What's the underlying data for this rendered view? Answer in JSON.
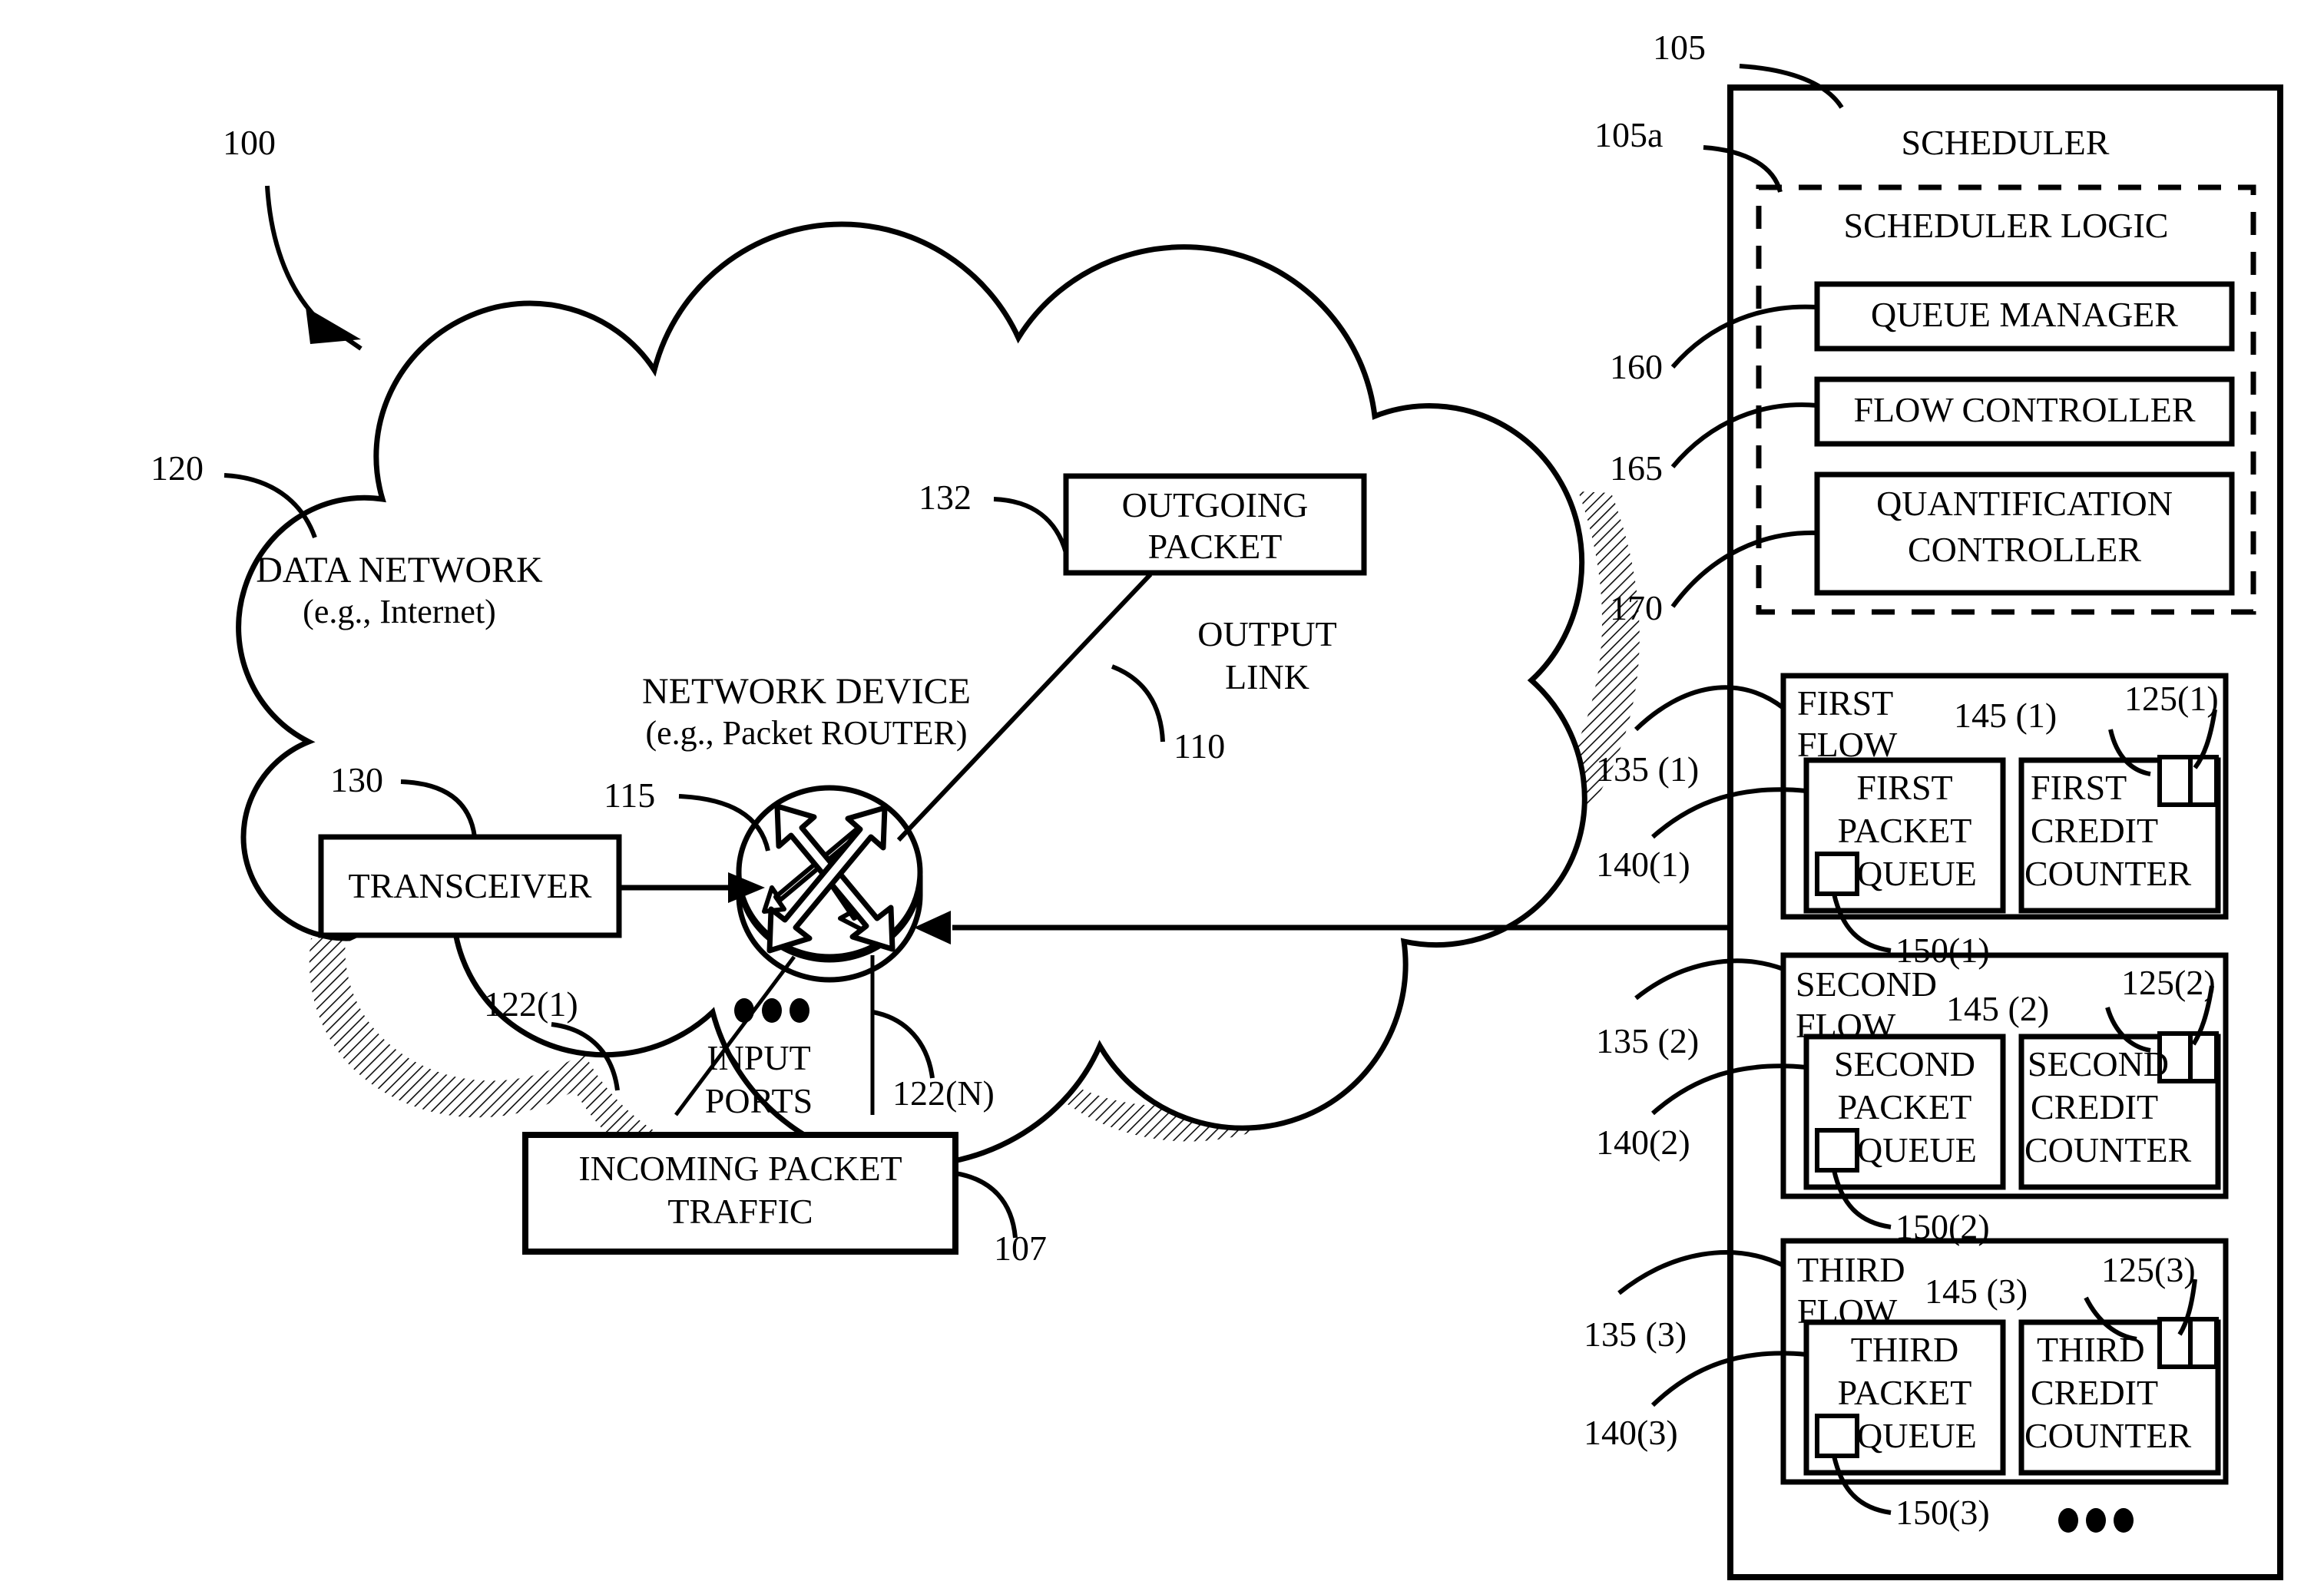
{
  "figure": {
    "ref_main": "100",
    "title_hidden": ""
  },
  "cloud": {
    "ref": "120",
    "label_line1": "DATA NETWORK",
    "label_line2": "(e.g., Internet)"
  },
  "router": {
    "ref": "115",
    "label_line1": "NETWORK DEVICE",
    "label_line2": "(e.g., Packet ROUTER)",
    "icon": "router-crossed-arrows-icon"
  },
  "transceiver": {
    "ref": "130",
    "label": "TRANSCEIVER"
  },
  "outgoing_packet": {
    "ref": "132",
    "label_line1": "OUTGOING",
    "label_line2": "PACKET"
  },
  "output_link": {
    "ref": "110",
    "label_line1": "OUTPUT",
    "label_line2": "LINK"
  },
  "input_ports": {
    "ref_first": "122(1)",
    "ref_last": "122(N)",
    "label_line1": "INPUT",
    "label_line2": "PORTS",
    "ellipsis": "•••"
  },
  "incoming_traffic": {
    "ref": "107",
    "label_line1": "INCOMING PACKET",
    "label_line2": "TRAFFIC"
  },
  "scheduler": {
    "ref": "105",
    "title": "SCHEDULER",
    "logic": {
      "ref": "105a",
      "title": "SCHEDULER LOGIC",
      "modules": [
        {
          "ref": "160",
          "label": "QUEUE MANAGER"
        },
        {
          "ref": "165",
          "label": "FLOW CONTROLLER"
        },
        {
          "ref": "170",
          "label_line1": "QUANTIFICATION",
          "label_line2": "CONTROLLER"
        }
      ]
    },
    "flows": [
      {
        "flow_ref": "135 (1)",
        "flow_title_line1": "FIRST",
        "flow_title_line2": "FLOW",
        "queue_ref": "140(1)",
        "queue_ref_inner": "145 (1)",
        "queue_line1": "FIRST",
        "queue_line2": "PACKET",
        "queue_line3": "QUEUE",
        "queue_marker_ref": "150(1)",
        "counter_ref": "125(1)",
        "counter_line1": "FIRST",
        "counter_line2": "CREDIT",
        "counter_line3": "COUNTER"
      },
      {
        "flow_ref": "135 (2)",
        "flow_title_line1": "SECOND",
        "flow_title_line2": "FLOW",
        "queue_ref": "140(2)",
        "queue_ref_inner": "145 (2)",
        "queue_line1": "SECOND",
        "queue_line2": "PACKET",
        "queue_line3": "QUEUE",
        "queue_marker_ref": "150(2)",
        "counter_ref": "125(2)",
        "counter_line1": "SECOND",
        "counter_line2": "CREDIT",
        "counter_line3": "COUNTER"
      },
      {
        "flow_ref": "135 (3)",
        "flow_title_line1": "THIRD",
        "flow_title_line2": "FLOW",
        "queue_ref": "140(3)",
        "queue_ref_inner": "145 (3)",
        "queue_line1": "THIRD",
        "queue_line2": "PACKET",
        "queue_line3": "QUEUE",
        "queue_marker_ref": "150(3)",
        "counter_ref": "125(3)",
        "counter_line1": "THIRD",
        "counter_line2": "CREDIT",
        "counter_line3": "COUNTER"
      }
    ],
    "more_flows_ellipsis": "•••"
  },
  "colors": {
    "ink": "#000000",
    "paper": "#ffffff",
    "shadow": "#555555"
  }
}
